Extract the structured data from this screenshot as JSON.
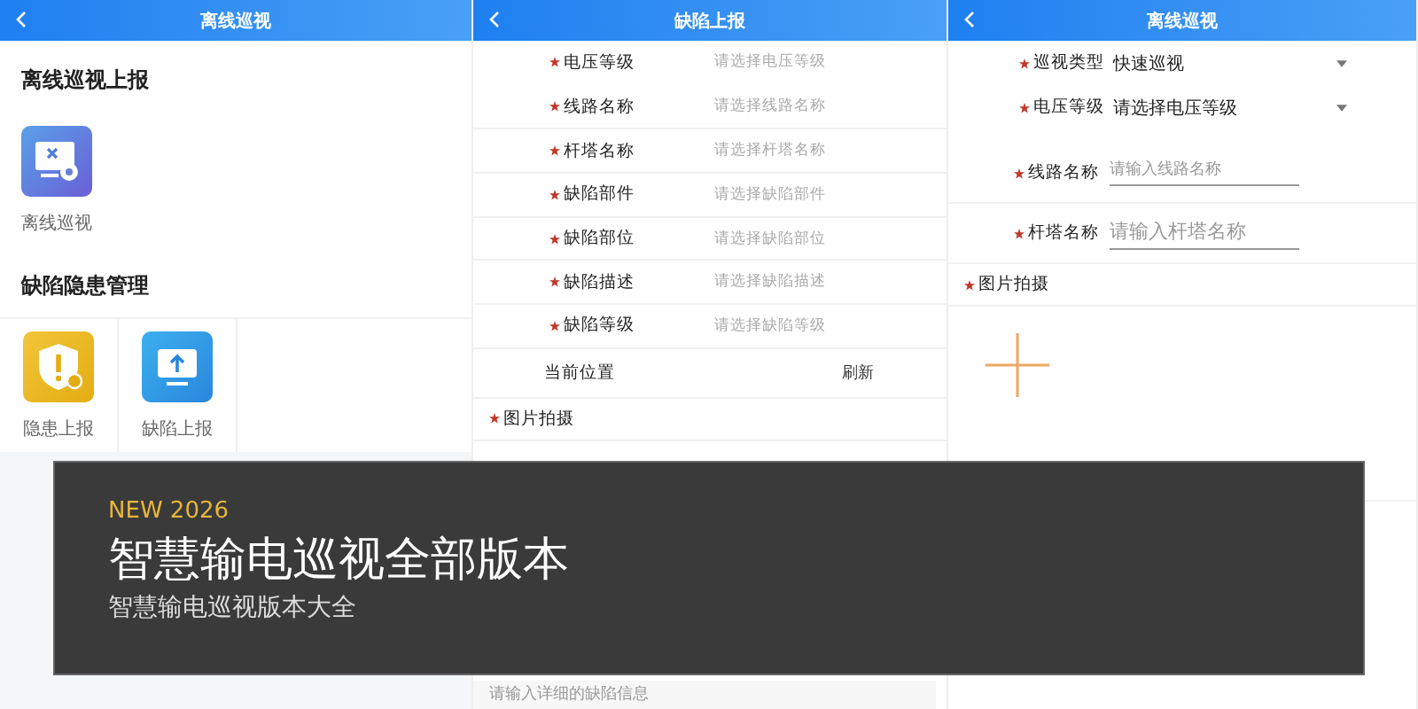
{
  "offline_menu": {
    "title": "离线巡视",
    "sections": [
      {
        "heading": "离线巡视上报",
        "items": [
          {
            "label": "离线巡视",
            "kind": "patrol"
          }
        ]
      },
      {
        "heading": "缺陷隐患管理",
        "items": [
          {
            "label": "隐患上报",
            "kind": "hazard"
          },
          {
            "label": "缺陷上报",
            "kind": "defect"
          }
        ]
      }
    ]
  },
  "defect_report": {
    "title": "缺陷上报",
    "fields": [
      {
        "label": "电压等级",
        "placeholder": "请选择电压等级",
        "required": true
      },
      {
        "label": "线路名称",
        "placeholder": "请选择线路名称",
        "required": true
      },
      {
        "label": "杆塔名称",
        "placeholder": "请选择杆塔名称",
        "required": true
      },
      {
        "label": "缺陷部件",
        "placeholder": "请选择缺陷部件",
        "required": true
      },
      {
        "label": "缺陷部位",
        "placeholder": "请选择缺陷部位",
        "required": true
      },
      {
        "label": "缺陷描述",
        "placeholder": "请选择缺陷描述",
        "required": true
      },
      {
        "label": "缺陷等级",
        "placeholder": "请选择缺陷等级",
        "required": true
      }
    ],
    "location": {
      "label": "当前位置",
      "action": "刷新"
    },
    "photo": {
      "label": "图片拍摄",
      "required": true
    },
    "description": {
      "placeholder": "请输入详细的缺陷信息"
    }
  },
  "offline_patrol": {
    "title": "离线巡视",
    "fields": [
      {
        "kind": "select",
        "label": "巡视类型",
        "value": "快速巡视",
        "required": true
      },
      {
        "kind": "select",
        "label": "电压等级",
        "value": "请选择电压等级",
        "required": true
      },
      {
        "kind": "input",
        "label": "线路名称",
        "placeholder": "请输入线路名称",
        "required": true
      },
      {
        "kind": "input",
        "label": "杆塔名称",
        "placeholder": "请输入杆塔名称",
        "required": true
      }
    ],
    "photo": {
      "label": "图片拍摄",
      "required": true
    }
  },
  "banner": {
    "tag": "NEW 2026",
    "title": "智慧输电巡视全部版本",
    "subtitle": "智慧输电巡视版本大全"
  }
}
